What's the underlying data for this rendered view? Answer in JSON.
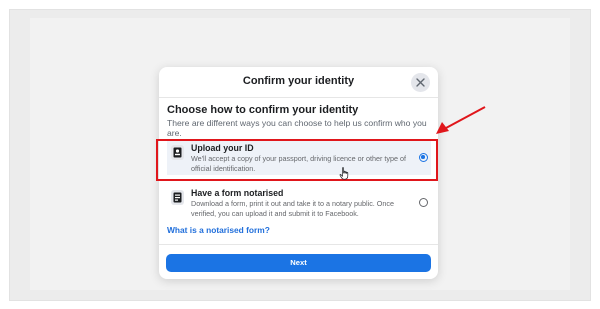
{
  "modal": {
    "title": "Confirm your identity",
    "heading": "Choose how to confirm your identity",
    "subtext": "There are different ways you can choose to help us confirm who you are.",
    "options": [
      {
        "title": "Upload your ID",
        "description": "We'll accept a copy of your passport, driving licence or other type of official identification.",
        "selected": true,
        "icon": "id-card-icon"
      },
      {
        "title": "Have a form notarised",
        "description": "Download a form, print it out and take it to a notary public. Once verified, you can upload it and submit it to Facebook.",
        "selected": false,
        "icon": "document-icon"
      }
    ],
    "link_text": "What is a notarised form?",
    "next_label": "Next"
  },
  "colors": {
    "accent": "#1b74e4",
    "link": "#216fdb",
    "annotation_red": "#e0161b"
  }
}
